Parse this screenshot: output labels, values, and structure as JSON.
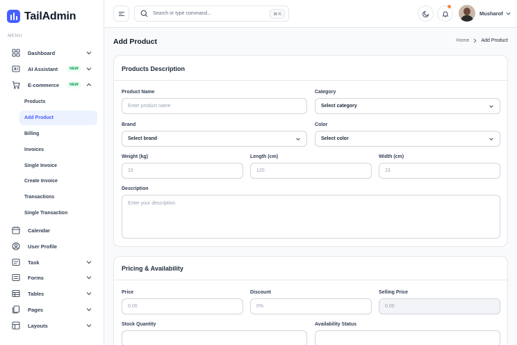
{
  "brand": {
    "name": "TailAdmin"
  },
  "sidebar": {
    "menu_title": "MENU",
    "items": [
      {
        "label": "Dashboard",
        "icon": "grid-icon",
        "chevron": "down"
      },
      {
        "label": "AI Assistant",
        "icon": "ai-icon",
        "badge": "NEW",
        "chevron": "down"
      },
      {
        "label": "E-commerce",
        "icon": "cart-icon",
        "badge": "NEW",
        "chevron": "up"
      },
      {
        "label": "Calendar",
        "icon": "calendar-icon"
      },
      {
        "label": "User Profile",
        "icon": "user-circle-icon"
      },
      {
        "label": "Task",
        "icon": "task-icon",
        "chevron": "down"
      },
      {
        "label": "Forms",
        "icon": "forms-icon",
        "chevron": "down"
      },
      {
        "label": "Tables",
        "icon": "table-icon",
        "chevron": "down"
      },
      {
        "label": "Pages",
        "icon": "pages-icon",
        "chevron": "down"
      },
      {
        "label": "Layouts",
        "icon": "layouts-icon",
        "chevron": "down"
      }
    ],
    "ecommerce_sub": [
      "Products",
      "Add Product",
      "Billing",
      "Invoices",
      "Single Invoice",
      "Create Invoice",
      "Transactions",
      "Single Transaction"
    ],
    "active_sub": "Add Product"
  },
  "header": {
    "search_placeholder": "Search or type command...",
    "search_shortcut": "⌘ K",
    "user_name": "Musharof"
  },
  "page": {
    "title": "Add Product",
    "breadcrumb": [
      "Home",
      "Add Product"
    ]
  },
  "products_description": {
    "title": "Products Description",
    "product_name": {
      "label": "Product Name",
      "placeholder": "Enter product name"
    },
    "category": {
      "label": "Category",
      "value": "Select category"
    },
    "brand": {
      "label": "Brand",
      "value": "Select brand"
    },
    "color": {
      "label": "Color",
      "value": "Select color"
    },
    "weight": {
      "label": "Weight (kg)",
      "placeholder": "15"
    },
    "length": {
      "label": "Length (cm)",
      "placeholder": "120"
    },
    "width": {
      "label": "Width (cm)",
      "placeholder": "23"
    },
    "description": {
      "label": "Description",
      "placeholder": "Enter your description"
    }
  },
  "pricing": {
    "title": "Pricing & Availability",
    "price": {
      "label": "Price",
      "placeholder": "0.00"
    },
    "discount": {
      "label": "Discount",
      "placeholder": "0%"
    },
    "selling_price": {
      "label": "Selling Price",
      "placeholder": "0.00"
    },
    "stock_quantity": {
      "label": "Stock Quantity"
    },
    "availability_status": {
      "label": "Availability Status"
    }
  },
  "colors": {
    "accent": "#465fff",
    "active_bg": "#ecf3ff",
    "badge_text": "#039855",
    "badge_bg": "#ecfdf3",
    "notification": "#fd853a"
  }
}
